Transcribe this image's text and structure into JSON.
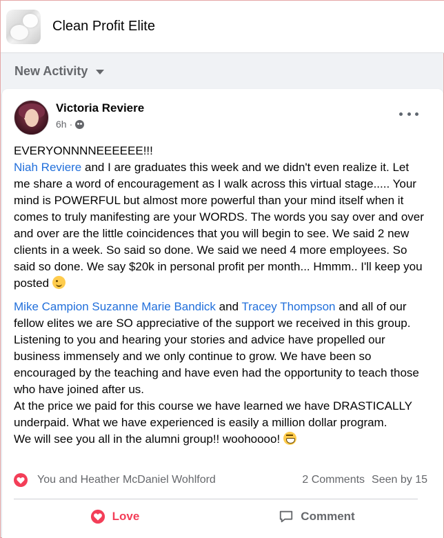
{
  "group": {
    "name": "Clean Profit Elite"
  },
  "feed_filter": {
    "label": "New Activity"
  },
  "post": {
    "author": "Victoria Reviere",
    "time": "6h",
    "separator": "·",
    "paragraph1": {
      "line1": "EVERYONNNNEEEEEE!!!",
      "mention": "Niah Reviere",
      "text": " and I are graduates this week and we didn't even realize it. Let me share a word of encouragement as I walk across this virtual stage..... Your mind is POWERFUL but almost more powerful than your mind itself when it comes to truly manifesting are your WORDS. The words you say over and over and over are the little coincidences that you will begin to see. We said 2 new clients in a week. So said so done. We said we need 4 more employees. So said so done. We say $20k in personal profit per month...  Hmmm.. I'll keep you posted "
    },
    "paragraph2": {
      "mention1": "Mike Campion",
      "mention2": "Suzanne Marie Bandick",
      "and_word": " and ",
      "mention3": "Tracey Thompson",
      "text": " and all of our fellow elites we are SO appreciative of the support we received in this group. Listening to you and hearing your stories and advice have propelled our business immensely and we only continue to grow. We have been so encouraged by the teaching and have even had the opportunity to teach those who have joined after us.",
      "line2": "At the price we paid for this course we have learned we have DRASTICALLY  underpaid. What we have experienced is easily a million dollar program.",
      "line3": "We will see you all in the alumni group!! woohoooo! "
    },
    "reactions": {
      "reactors": "You and Heather McDaniel Wohlford",
      "comments": "2 Comments",
      "seen_by": "Seen by 15"
    },
    "actions": {
      "love": "Love",
      "comment": "Comment"
    }
  },
  "colors": {
    "link": "#216fdb",
    "love": "#f33e58",
    "muted": "#65676b"
  }
}
